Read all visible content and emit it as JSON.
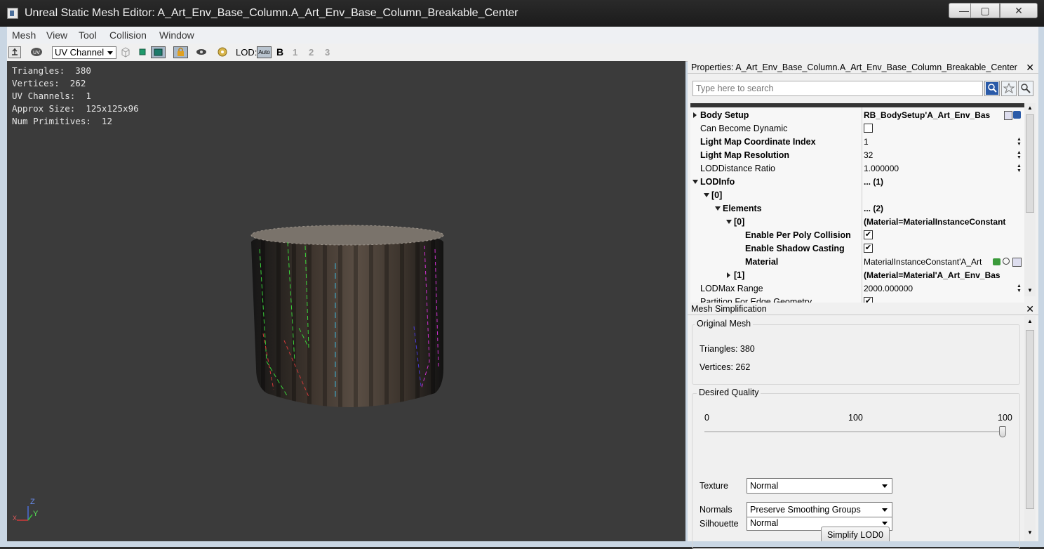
{
  "window": {
    "title": "Unreal Static Mesh Editor: A_Art_Env_Base_Column.A_Art_Env_Base_Column_Breakable_Center",
    "min_glyph": "—",
    "max_glyph": "▢",
    "close_glyph": "✕"
  },
  "menu": [
    "Mesh",
    "View",
    "Tool",
    "Collision",
    "Window"
  ],
  "toolbar": {
    "uv_channel_label": "UV Channel",
    "lod_label": "LOD:",
    "lod_auto": "Auto",
    "lod_levels": [
      "B",
      "1",
      "2",
      "3"
    ]
  },
  "viewport": {
    "stats": [
      "Triangles:  380",
      "Vertices:  262",
      "UV Channels:  1",
      "Approx Size:  125x125x96",
      "Num Primitives:  12"
    ],
    "axis": {
      "z": "Z",
      "y": "Y",
      "x": "X"
    }
  },
  "properties": {
    "title": "Properties: A_Art_Env_Base_Column.A_Art_Env_Base_Column_Breakable_Center",
    "close_glyph": "✕",
    "search_placeholder": "Type here to search",
    "rows": [
      {
        "name": "Body Setup",
        "value": "RB_BodySetup'A_Art_Env_Bas"
      },
      {
        "name": "Can Become Dynamic",
        "value": ""
      },
      {
        "name": "Light Map Coordinate Index",
        "value": "1"
      },
      {
        "name": "Light Map Resolution",
        "value": "32"
      },
      {
        "name": "LODDistance Ratio",
        "value": "1.000000"
      },
      {
        "name": "LODInfo",
        "value": "... (1)"
      },
      {
        "name": "[0]",
        "value": ""
      },
      {
        "name": "Elements",
        "value": "... (2)"
      },
      {
        "name": "[0]",
        "value": "(Material=MaterialInstanceConstant"
      },
      {
        "name": "Enable Per Poly Collision",
        "value": ""
      },
      {
        "name": "Enable Shadow Casting",
        "value": ""
      },
      {
        "name": "Material",
        "value": "MaterialInstanceConstant'A_Art"
      },
      {
        "name": "[1]",
        "value": "(Material=Material'A_Art_Env_Bas"
      },
      {
        "name": "LODMax Range",
        "value": "2000.000000"
      },
      {
        "name": "Partition For Edge Geometry",
        "value": ""
      }
    ]
  },
  "mesh_simplification": {
    "title": "Mesh Simplification",
    "close_glyph": "✕",
    "original_mesh_label": "Original Mesh",
    "triangles_text": "Triangles: 380",
    "vertices_text": "Vertices: 262",
    "desired_quality_label": "Desired Quality",
    "slider_min": "0",
    "slider_mid": "100",
    "slider_max": "100",
    "slider_value": 1.0,
    "silhouette_label": "Silhouette",
    "silhouette_value": "Normal",
    "texture_label": "Texture",
    "texture_value": "Normal",
    "normals_label": "Normals",
    "normals_value": "Preserve Smoothing Groups",
    "simplify_button": "Simplify LOD0"
  }
}
